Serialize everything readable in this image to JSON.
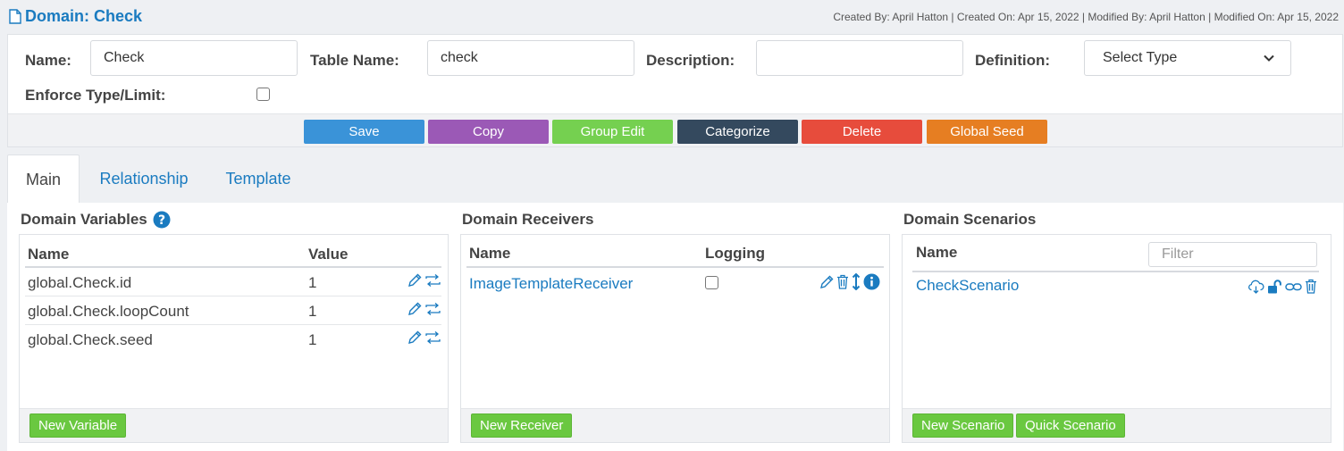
{
  "header": {
    "title": "Domain: Check",
    "meta": "Created By: April Hatton | Created On: Apr 15, 2022 | Modified By: April Hatton | Modified On: Apr 15, 2022"
  },
  "form": {
    "name_label": "Name:",
    "name_value": "Check",
    "table_name_label": "Table Name:",
    "table_name_value": "check",
    "description_label": "Description:",
    "description_value": "",
    "definition_label": "Definition:",
    "definition_value": "Select Type",
    "enforce_label": "Enforce Type/Limit:",
    "enforce_checked": false
  },
  "actions": {
    "save": "Save",
    "copy": "Copy",
    "group_edit": "Group Edit",
    "categorize": "Categorize",
    "delete": "Delete",
    "global_seed": "Global Seed"
  },
  "tabs": [
    {
      "label": "Main",
      "active": true
    },
    {
      "label": "Relationship",
      "active": false
    },
    {
      "label": "Template",
      "active": false
    }
  ],
  "variables": {
    "title": "Domain Variables",
    "col_name": "Name",
    "col_value": "Value",
    "rows": [
      {
        "name": "global.Check.id",
        "value": "1"
      },
      {
        "name": "global.Check.loopCount",
        "value": "1"
      },
      {
        "name": "global.Check.seed",
        "value": "1"
      }
    ],
    "new_button": "New Variable"
  },
  "receivers": {
    "title": "Domain Receivers",
    "col_name": "Name",
    "col_logging": "Logging",
    "rows": [
      {
        "name": "ImageTemplateReceiver",
        "logging": false
      }
    ],
    "new_button": "New Receiver"
  },
  "scenarios": {
    "title": "Domain Scenarios",
    "col_name": "Name",
    "filter_placeholder": "Filter",
    "rows": [
      {
        "name": "CheckScenario"
      }
    ],
    "new_button": "New Scenario",
    "quick_button": "Quick Scenario"
  },
  "colors": {
    "link": "#1a7bc0",
    "save": "#3a93d8",
    "copy": "#9b59b6",
    "group_edit": "#75d050",
    "categorize": "#34495e",
    "delete": "#e74c3c",
    "global_seed": "#e67e22",
    "green": "#6ac840"
  }
}
